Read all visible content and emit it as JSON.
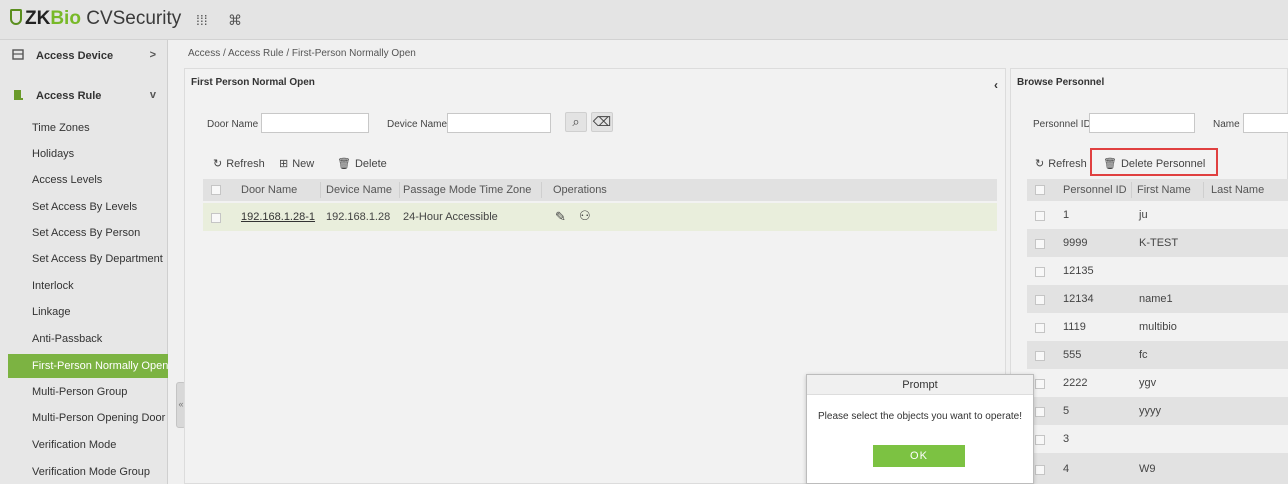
{
  "app": {
    "logo_zk": "ZK",
    "logo_bio": "Bio",
    "logo_cv": " CVSecurity",
    "apps_icon": "grid-dots-icon",
    "cmd_icon": "command-icon"
  },
  "sidebar": {
    "groups": [
      {
        "label": "Access Device",
        "chevron": ">"
      },
      {
        "label": "Access Rule",
        "chevron": "v"
      }
    ],
    "items": [
      {
        "label": "Time Zones"
      },
      {
        "label": "Holidays"
      },
      {
        "label": "Access Levels"
      },
      {
        "label": "Set Access By Levels"
      },
      {
        "label": "Set Access By Person"
      },
      {
        "label": "Set Access By Department"
      },
      {
        "label": "Interlock"
      },
      {
        "label": "Linkage"
      },
      {
        "label": "Anti-Passback"
      },
      {
        "label": "First-Person Normally Open",
        "active": true
      },
      {
        "label": "Multi-Person Group"
      },
      {
        "label": "Multi-Person Opening Door"
      },
      {
        "label": "Verification Mode"
      },
      {
        "label": "Verification Mode Group"
      }
    ],
    "collapse_glyph": "«"
  },
  "breadcrumb": "Access / Access Rule / First-Person Normally Open",
  "left_panel": {
    "title": "First Person Normal Open",
    "collapse_glyph": "‹",
    "filters": {
      "door_name_label": "Door Name",
      "device_name_label": "Device Name",
      "door_name_value": "",
      "device_name_value": ""
    },
    "toolbar": {
      "refresh": "Refresh",
      "new": "New",
      "delete": "Delete"
    },
    "columns": [
      "Door Name",
      "Device Name",
      "Passage Mode Time Zone",
      "Operations"
    ],
    "rows": [
      {
        "door": "192.168.1.28-1",
        "device": "192.168.1.28",
        "zone": "24-Hour Accessible"
      }
    ]
  },
  "right_panel": {
    "title": "Browse Personnel",
    "filters": {
      "personnel_id_label": "Personnel ID",
      "name_label": "Name"
    },
    "toolbar": {
      "refresh": "Refresh",
      "delete_personnel": "Delete Personnel"
    },
    "columns": [
      "Personnel ID",
      "First Name",
      "Last Name"
    ],
    "rows": [
      {
        "id": "1",
        "first": "ju",
        "last": ""
      },
      {
        "id": "9999",
        "first": "K-TEST",
        "last": ""
      },
      {
        "id": "12135",
        "first": "",
        "last": ""
      },
      {
        "id": "12134",
        "first": "name1",
        "last": ""
      },
      {
        "id": "1119",
        "first": "multibio",
        "last": ""
      },
      {
        "id": "555",
        "first": "fc",
        "last": ""
      },
      {
        "id": "2222",
        "first": "ygv",
        "last": ""
      },
      {
        "id": "5",
        "first": "yyyy",
        "last": ""
      },
      {
        "id": "3",
        "first": "",
        "last": ""
      },
      {
        "id": "4",
        "first": "W9",
        "last": ""
      }
    ]
  },
  "modal": {
    "title": "Prompt",
    "message": "Please select the objects you want to operate!",
    "ok": "OK"
  }
}
